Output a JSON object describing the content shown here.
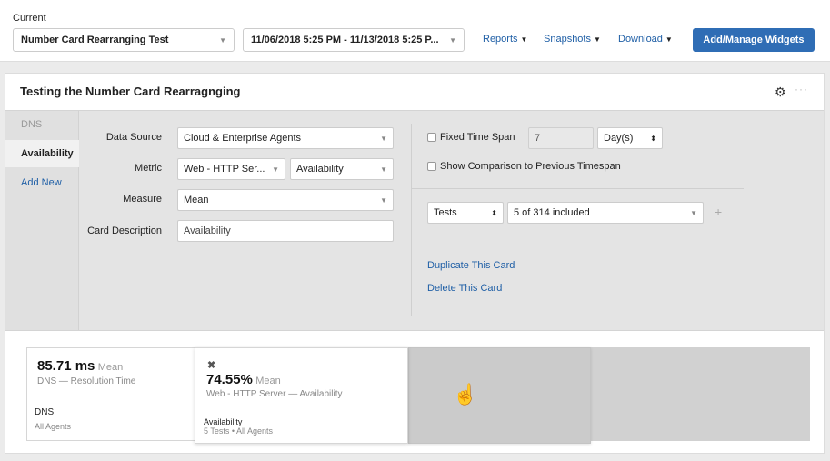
{
  "topbar": {
    "current_label": "Current",
    "dashboard_select": "Number Card Rearranging Test",
    "date_range_select": "11/06/2018 5:25 PM - 11/13/2018 5:25 P...",
    "menus": [
      "Reports",
      "Snapshots",
      "Download"
    ],
    "primary_button": "Add/Manage Widgets"
  },
  "widget": {
    "title": "Testing the Number Card Rearragnging",
    "icons": [
      "gear-icon",
      "more-icon"
    ]
  },
  "sidebar": {
    "items": [
      {
        "label": "DNS",
        "state": "inactive"
      },
      {
        "label": "Availability",
        "state": "active"
      },
      {
        "label": "Add New",
        "state": "link"
      }
    ]
  },
  "form": {
    "data_source": {
      "label": "Data Source",
      "value": "Cloud & Enterprise Agents"
    },
    "metric": {
      "label": "Metric",
      "value1": "Web - HTTP Ser...",
      "value2": "Availability"
    },
    "measure": {
      "label": "Measure",
      "value": "Mean"
    },
    "card_description": {
      "label": "Card Description",
      "value": "Availability"
    },
    "fixed_time_span": {
      "label": "Fixed Time Span",
      "checked": false,
      "value": "7",
      "unit": "Day(s)"
    },
    "show_comparison": {
      "label": "Show Comparison to Previous Timespan",
      "checked": false
    },
    "filter": {
      "type": "Tests",
      "value": "5 of 314 included"
    },
    "duplicate_link": "Duplicate This Card",
    "delete_link": "Delete This Card"
  },
  "cards": [
    {
      "value": "85.71 ms",
      "unit": "Mean",
      "subtitle": "DNS — Resolution Time",
      "name": "DNS",
      "detail": "All Agents"
    },
    {
      "value": "74.55%",
      "unit": "Mean",
      "subtitle": "Web - HTTP Server — Availability",
      "name": "Availability",
      "detail": "5 Tests • All Agents"
    }
  ],
  "colors": {
    "primary": "#2f6db5",
    "link": "#1f5fa6"
  }
}
